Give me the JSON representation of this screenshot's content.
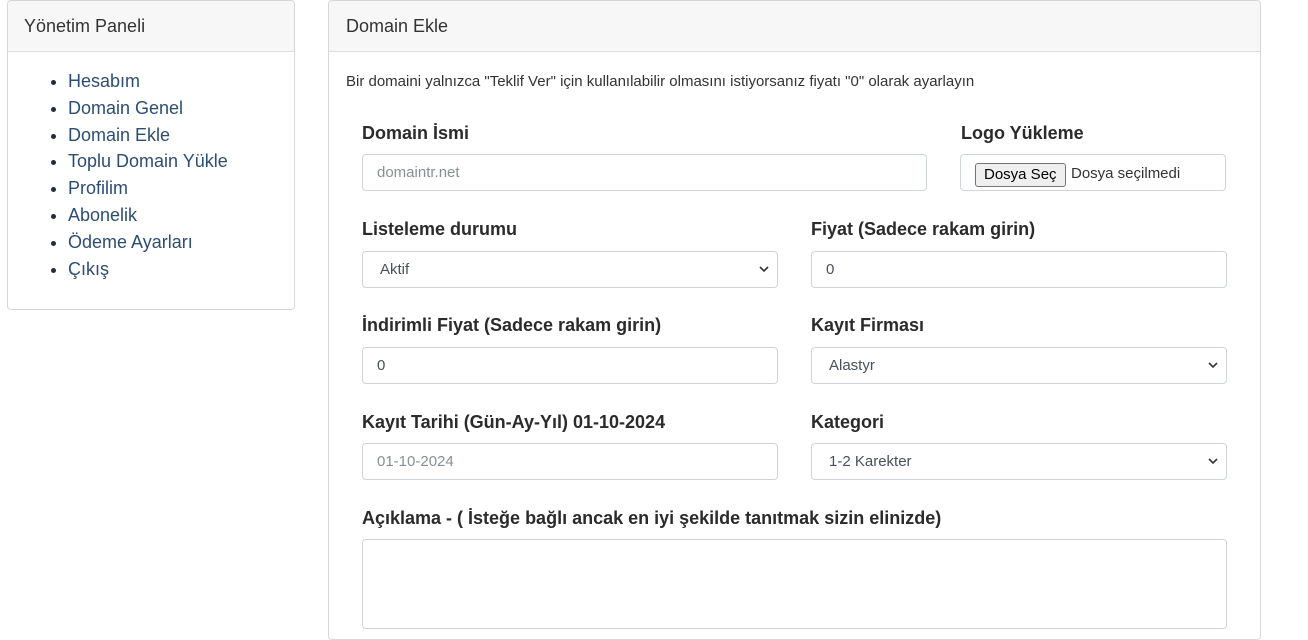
{
  "sidebar": {
    "title": "Yönetim Paneli",
    "items": [
      {
        "label": "Hesabım"
      },
      {
        "label": "Domain Genel"
      },
      {
        "label": "Domain Ekle"
      },
      {
        "label": "Toplu Domain Yükle"
      },
      {
        "label": "Profilim"
      },
      {
        "label": "Abonelik"
      },
      {
        "label": "Ödeme Ayarları"
      },
      {
        "label": "Çıkış"
      }
    ]
  },
  "main": {
    "title": "Domain Ekle",
    "hint": "Bir domaini yalnızca \"Teklif Ver\" için kullanılabilir olmasını istiyorsanız fiyatı \"0\" olarak ayarlayın",
    "domain_name": {
      "label": "Domain İsmi",
      "placeholder": "domaintr.net",
      "value": ""
    },
    "logo": {
      "label": "Logo Yükleme",
      "button": "Dosya Seç",
      "status": "Dosya seçilmedi"
    },
    "listing_status": {
      "label": "Listeleme durumu",
      "selected": "Aktif"
    },
    "price": {
      "label": "Fiyat (Sadece rakam girin)",
      "value": "0"
    },
    "discount_price": {
      "label": "İndirimli Fiyat (Sadece rakam girin)",
      "value": "0"
    },
    "registrar": {
      "label": "Kayıt Firması",
      "selected": "Alastyr"
    },
    "reg_date": {
      "label": "Kayıt Tarihi (Gün-Ay-Yıl) 01-10-2024",
      "placeholder": "01-10-2024",
      "value": ""
    },
    "category": {
      "label": "Kategori",
      "selected": "1-2 Karekter"
    },
    "description": {
      "label": "Açıklama - ( İsteğe bağlı ancak en iyi şekilde tanıtmak sizin elinizde)"
    }
  }
}
